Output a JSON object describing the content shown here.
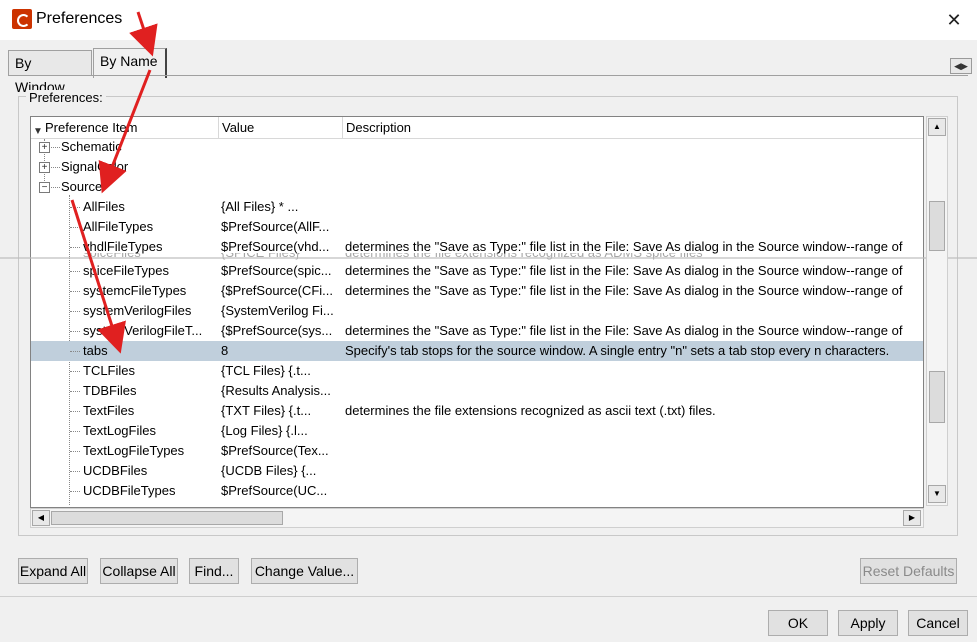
{
  "window": {
    "title": "Preferences",
    "close_glyph": "✕"
  },
  "tabs": [
    {
      "label": "By Window",
      "active": false
    },
    {
      "label": "By Name",
      "active": true
    }
  ],
  "tab_scroll_glyph": "◀▶",
  "group_label": "Preferences:",
  "table": {
    "headers": [
      "Preference Item",
      "Value",
      "Description"
    ],
    "categories": [
      {
        "name": "Schematic",
        "expanded": false
      },
      {
        "name": "SignalColor",
        "expanded": false
      },
      {
        "name": "Source",
        "expanded": true
      }
    ],
    "rows_before_split": [
      {
        "name": "AllFiles",
        "value": "{All Files}     *     ...",
        "desc": ""
      },
      {
        "name": "AllFileTypes",
        "value": " $PrefSource(AllF...",
        "desc": ""
      },
      {
        "name": "vhdlFileTypes",
        "value": " $PrefSource(vhd...",
        "desc": "determines the \"Save as Type:\" file list in the File: Save As dialog in the Source window--range of"
      }
    ],
    "ghost_row": {
      "name": "spiceFiles",
      "value": "{SPICE Files}",
      "desc": "determines the file extensions recognized as ADMS spice files"
    },
    "rows_after_split": [
      {
        "name": "spiceFileTypes",
        "value": " $PrefSource(spic...",
        "desc": "determines the \"Save as Type:\" file list in the File: Save As dialog in the Source window--range of"
      },
      {
        "name": "systemcFileTypes",
        "value": "{$PrefSource(CFi...",
        "desc": "determines the \"Save as Type:\" file list in the File: Save As dialog in the Source window--range of"
      },
      {
        "name": "systemVerilogFiles",
        "value": "{SystemVerilog Fi...",
        "desc": ""
      },
      {
        "name": "systemVerilogFileT...",
        "value": "{$PrefSource(sys...",
        "desc": "determines the \"Save as Type:\" file list in the File: Save As dialog in the Source window--range of"
      },
      {
        "name": "tabs",
        "value": "8",
        "desc": "Specify's tab stops for the source window. A single entry \"n\" sets a tab stop every n characters.",
        "selected": true
      },
      {
        "name": "TCLFiles",
        "value": "{TCL Files}      {.t...",
        "desc": ""
      },
      {
        "name": "TDBFiles",
        "value": "{Results Analysis...",
        "desc": ""
      },
      {
        "name": "TextFiles",
        "value": "{TXT Files}      {.t...",
        "desc": "determines the file extensions recognized as ascii text (.txt) files."
      },
      {
        "name": "TextLogFiles",
        "value": "{Log Files}      {.l...",
        "desc": ""
      },
      {
        "name": "TextLogFileTypes",
        "value": " $PrefSource(Tex...",
        "desc": ""
      },
      {
        "name": "UCDBFiles",
        "value": "{UCDB Files}     {...",
        "desc": ""
      },
      {
        "name": "UCDBFileTypes",
        "value": " $PrefSource(UC...",
        "desc": ""
      }
    ]
  },
  "scroll_glyphs": {
    "up": "▲",
    "down": "▼",
    "left": "◀",
    "right": "▶"
  },
  "buttons": {
    "expand_all": "Expand All",
    "collapse_all": "Collapse All",
    "find": "Find...",
    "change_value": "Change Value...",
    "reset_defaults": "Reset Defaults",
    "ok": "OK",
    "apply": "Apply",
    "cancel": "Cancel"
  },
  "colors": {
    "selection": "#c0cfdc",
    "annotation_arrow": "#e02020",
    "app_icon": "#cc3300"
  }
}
